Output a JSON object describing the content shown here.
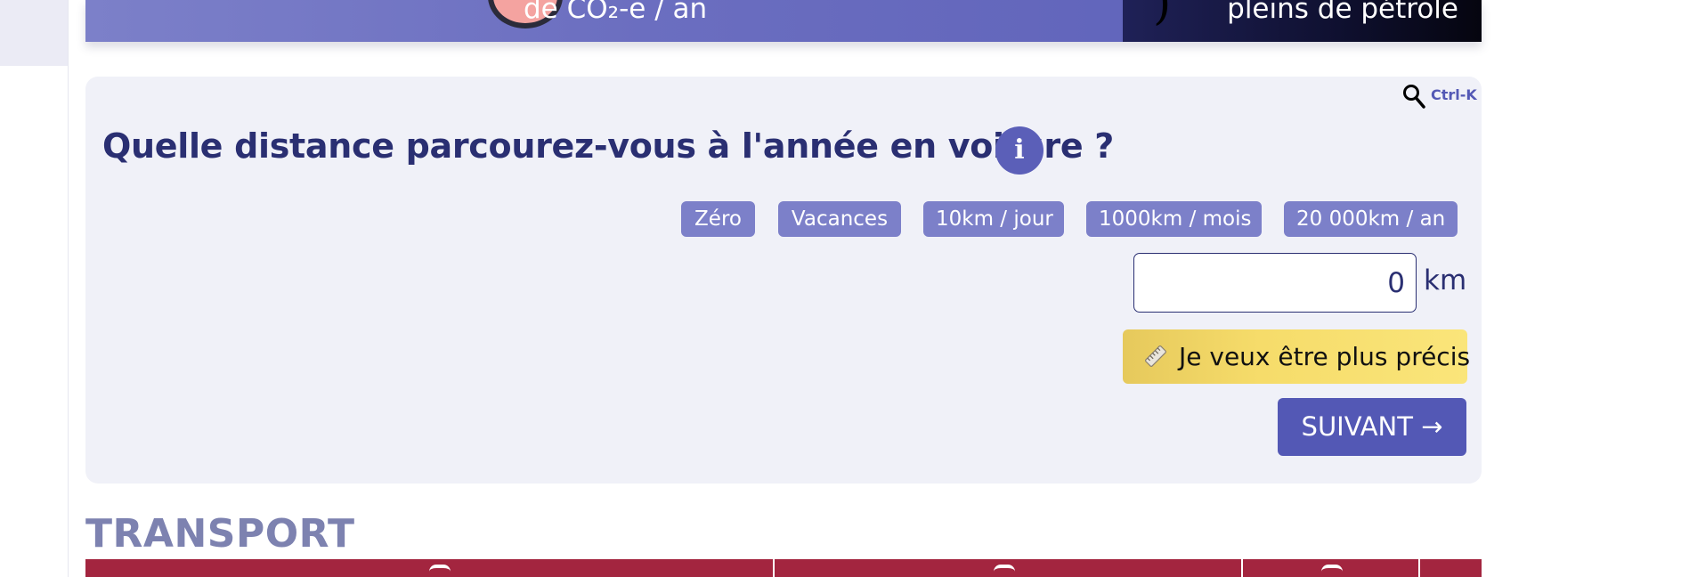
{
  "banner": {
    "co2_text": "de CO₂-e / an",
    "petrol_text": "pleins de pétrole"
  },
  "card": {
    "search_shortcut": "Ctrl-K",
    "question": "Quelle distance parcourez-vous à l'année en voiture ?",
    "info_symbol": "i",
    "suggestions": [
      "Zéro",
      "Vacances",
      "10km / jour",
      "1000km / mois",
      "20 000km / an"
    ],
    "distance_input": {
      "value": "0"
    },
    "unit": "km",
    "precise_button": "Je veux être plus précis",
    "next_button": "SUIVANT →"
  },
  "section": {
    "title": "TRANSPORT"
  },
  "icons": {
    "search": "search-icon",
    "info": "info-icon",
    "ruler": "ruler-icon"
  },
  "colors": {
    "primary": "#5358b5",
    "chip": "#7c80c9",
    "title": "#2a2f72",
    "card_bg": "#f0f1f8",
    "precise_yellow": "#f6dc6a",
    "transport_red": "#a3253f",
    "section_grey": "#7d82b0"
  }
}
